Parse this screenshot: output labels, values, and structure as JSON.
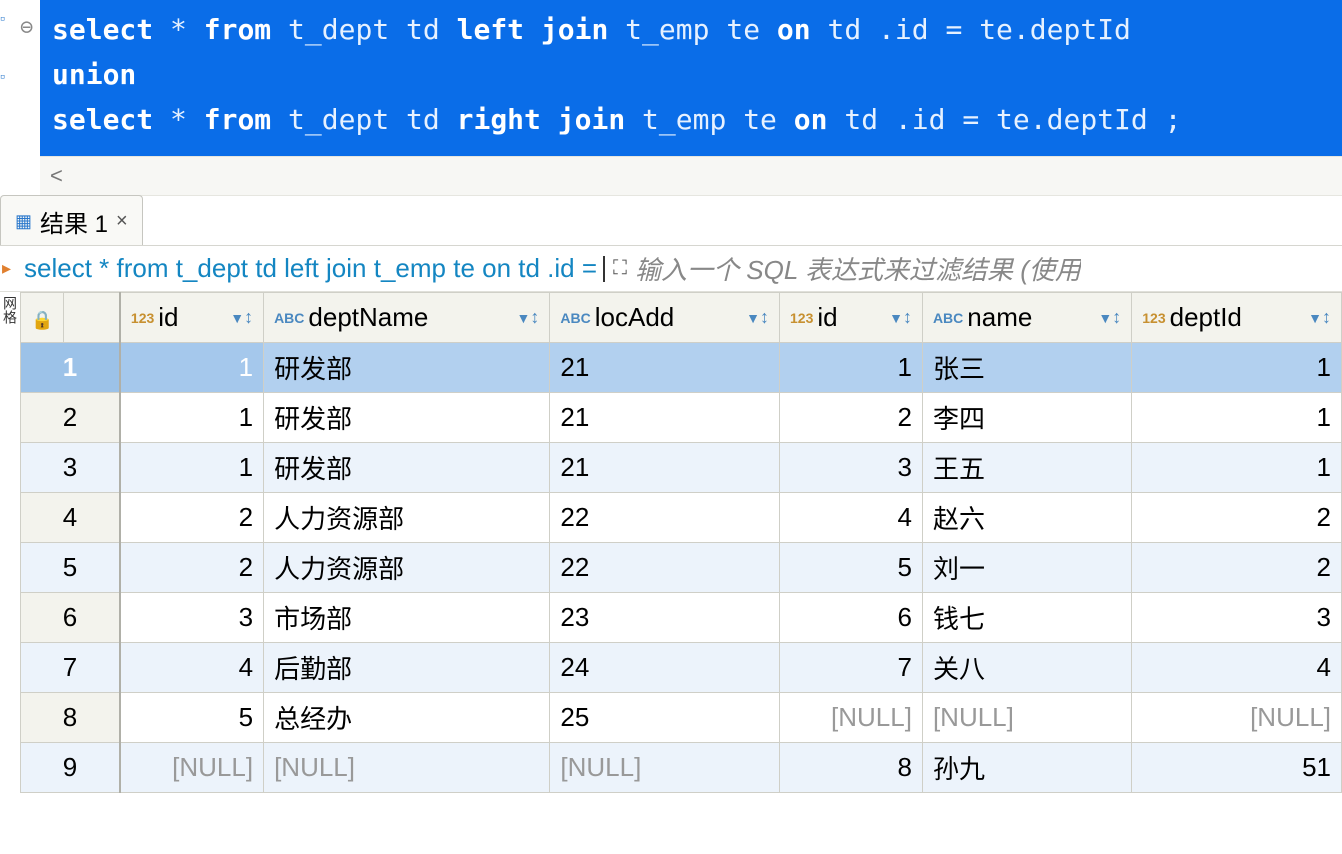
{
  "sql": {
    "line1_pre": "select",
    "line1_star": " * ",
    "line1_from": "from",
    "line1_t1": " t_dept td ",
    "line1_join": "left join",
    "line1_t2": " t_emp te ",
    "line1_on": "on",
    "line1_cond": " td .id = te.deptId",
    "line2": "union",
    "line3_pre": "select",
    "line3_star": " * ",
    "line3_from": "from",
    "line3_t1": " t_dept td ",
    "line3_join": "right join",
    "line3_t2": " t_emp te ",
    "line3_on": "on",
    "line3_cond": " td .id = te.deptId  ;"
  },
  "breadcrumb_arrow": "<",
  "tab_label": "结果 1",
  "tab_close": "×",
  "query_snippet": "select * from t_dept td left join t_emp te on td .id =",
  "filter_placeholder": "输入一个 SQL 表达式来过滤结果 (使用",
  "columns": [
    {
      "type": "123",
      "name": "id"
    },
    {
      "type": "ABC",
      "name": "deptName"
    },
    {
      "type": "ABC",
      "name": "locAdd"
    },
    {
      "type": "123",
      "name": "id"
    },
    {
      "type": "ABC",
      "name": "name"
    },
    {
      "type": "123",
      "name": "deptId"
    }
  ],
  "rows": [
    {
      "n": "1",
      "sel": true,
      "c": [
        "1",
        "研发部",
        "21",
        "1",
        "张三",
        "1"
      ]
    },
    {
      "n": "2",
      "c": [
        "1",
        "研发部",
        "21",
        "2",
        "李四",
        "1"
      ]
    },
    {
      "n": "3",
      "c": [
        "1",
        "研发部",
        "21",
        "3",
        "王五",
        "1"
      ]
    },
    {
      "n": "4",
      "c": [
        "2",
        "人力资源部",
        "22",
        "4",
        "赵六",
        "2"
      ]
    },
    {
      "n": "5",
      "c": [
        "2",
        "人力资源部",
        "22",
        "5",
        "刘一",
        "2"
      ]
    },
    {
      "n": "6",
      "c": [
        "3",
        "市场部",
        "23",
        "6",
        "钱七",
        "3"
      ]
    },
    {
      "n": "7",
      "c": [
        "4",
        "后勤部",
        "24",
        "7",
        "关八",
        "4"
      ]
    },
    {
      "n": "8",
      "c": [
        "5",
        "总经办",
        "25",
        "[NULL]",
        "[NULL]",
        "[NULL]"
      ]
    },
    {
      "n": "9",
      "c": [
        "[NULL]",
        "[NULL]",
        "[NULL]",
        "8",
        "孙九",
        "51"
      ]
    }
  ],
  "numeric_cols": [
    0,
    3,
    5
  ],
  "filter_sort_glyph": "⏷↕"
}
